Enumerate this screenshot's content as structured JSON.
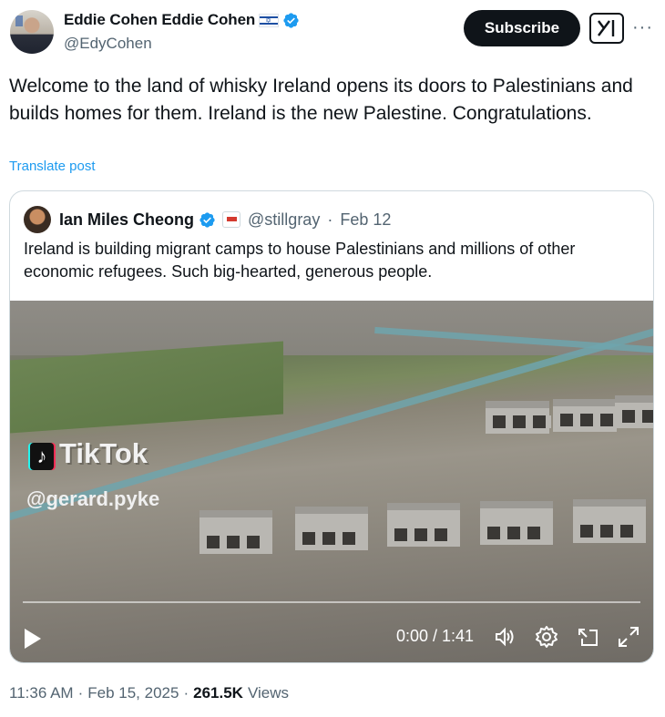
{
  "author": {
    "display_name": "Eddie Cohen Eddie Cohen",
    "handle": "@EdyCohen"
  },
  "actions": {
    "subscribe_label": "Subscribe",
    "more_label": "···"
  },
  "tweet": {
    "text": "Welcome to the land of whisky Ireland opens its doors to Palestinians and builds homes for them. Ireland is the new Palestine. Congratulations.",
    "translate_label": "Translate post"
  },
  "quoted": {
    "display_name": "Ian Miles Cheong",
    "handle": "@stillgray",
    "date": "Feb 12",
    "separator": "·",
    "text": "Ireland is building migrant camps to house Palestinians and millions of other economic refugees. Such big-hearted, generous people."
  },
  "video": {
    "watermark_brand": "TikTok",
    "watermark_user": "@gerard.pyke",
    "time_display": "0:00 / 1:41",
    "progress": 0
  },
  "meta": {
    "time": "11:36 AM",
    "date": "Feb 15, 2025",
    "separator": "·",
    "views_count": "261.5K",
    "views_label": "Views"
  },
  "colors": {
    "text": "#0f1419",
    "secondary": "#536471",
    "link": "#1d9bf0",
    "verified": "#1d9bf0",
    "border": "#cfd9de"
  }
}
